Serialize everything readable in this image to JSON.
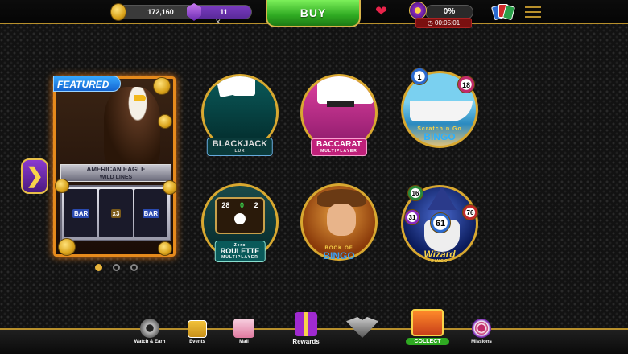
{
  "topbar": {
    "coins": "172,160",
    "gems": "11",
    "buy_label": "BUY",
    "level_progress": "0%",
    "timer": "00:05:01",
    "icons": [
      "coin-icon",
      "gem-icon",
      "heart-icon",
      "xp-icon",
      "cards-icon",
      "menu-icon"
    ]
  },
  "featured": {
    "badge": "FEATURED",
    "game_title": "AMERICAN EAGLE",
    "game_subtitle": "WILD LINES",
    "reel_symbols": [
      "BAR",
      "x3",
      "BAR"
    ],
    "pager_count": 3,
    "pager_active_index": 0
  },
  "games": [
    {
      "name": "blackjack",
      "title": "BLACKJACK",
      "subtitle": "LUX"
    },
    {
      "name": "baccarat",
      "title": "BACCARAT",
      "subtitle": "MULTIPLAYER"
    },
    {
      "name": "scratch-n-go-bingo",
      "title": "BINGO",
      "subtitle": "Scratch n Go",
      "balls": [
        "1",
        "18"
      ]
    },
    {
      "name": "roulette",
      "title": "ROULETTE",
      "subtitle": "MULTIPLAYER",
      "top_text": "Zero",
      "wheel_numbers": [
        "28",
        "0",
        "2"
      ]
    },
    {
      "name": "book-of-bingo",
      "title": "BINGO",
      "subtitle": "BOOK OF"
    },
    {
      "name": "wizard-bingo",
      "title": "Wizard",
      "subtitle": "BINGO",
      "balls": [
        "16",
        "31",
        "61",
        "76"
      ]
    }
  ],
  "bottom_nav": [
    {
      "name": "watch-earn",
      "label": "Watch & Earn"
    },
    {
      "name": "events",
      "label": "Events"
    },
    {
      "name": "mail",
      "label": "Mail"
    },
    {
      "name": "rewards",
      "label": "Rewards"
    },
    {
      "name": "club",
      "label": ""
    },
    {
      "name": "collect",
      "label": "COLLECT"
    },
    {
      "name": "missions",
      "label": "Missions"
    }
  ],
  "colors": {
    "accent_gold": "#d8a830",
    "buy_green": "#2faa22",
    "featured_orange": "#e68a1c",
    "gem_purple": "#7a3bc0",
    "timer_red": "#7a1010"
  }
}
